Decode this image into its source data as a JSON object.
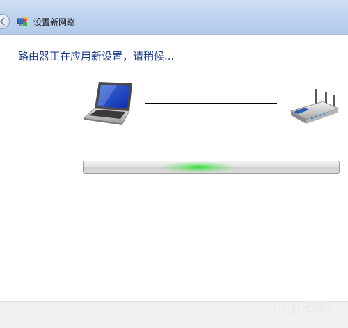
{
  "window": {
    "title": "设置新网络"
  },
  "main": {
    "status_message": "路由器正在应用新设置，请稍候..."
  },
  "progress": {
    "state": "indeterminate",
    "glow_color": "#28dc28"
  },
  "icons": {
    "back": "back-arrow-icon",
    "wizard": "network-wizard-icon",
    "laptop": "laptop-icon",
    "router": "router-icon"
  },
  "watermark": {
    "text": "Bai 经验"
  },
  "colors": {
    "titlebar": "#bed3ee",
    "status_text": "#1a3d8f",
    "footer": "#f0f0f0"
  }
}
